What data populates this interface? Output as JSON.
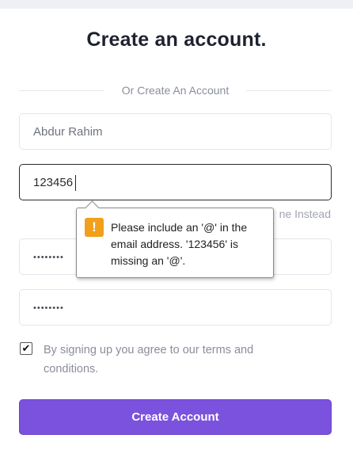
{
  "form": {
    "title": "Create an account.",
    "divider_text": "Or Create An Account",
    "name_value": "Abdur Rahim",
    "email_value": "123456",
    "password_masked": "••••••••",
    "confirm_password_masked": "••••••••",
    "alt_hint": "ne Instead",
    "terms_checked": true,
    "checkbox_mark": "✔",
    "terms_text": "By signing up you agree to our terms and conditions.",
    "submit_label": "Create Account"
  },
  "validation_tooltip": {
    "icon": "warning-icon",
    "icon_glyph": "!",
    "message": "Please include an '@' in the email address. '123456' is missing an '@'."
  },
  "colors": {
    "accent": "#7b52de",
    "warning": "#f0a01a"
  }
}
